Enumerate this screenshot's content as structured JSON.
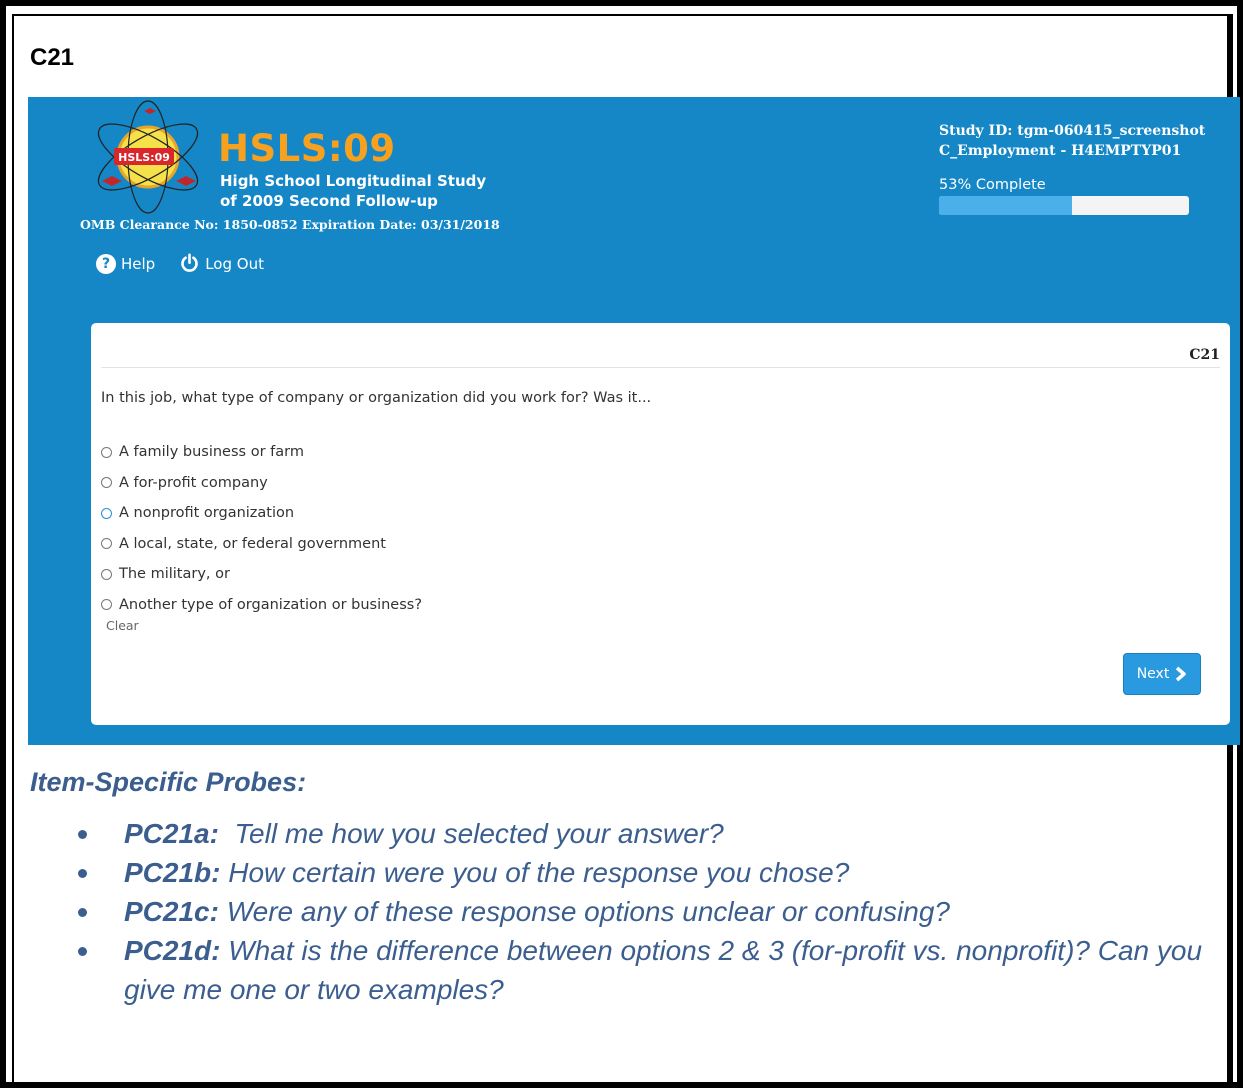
{
  "item_code": "C21",
  "app": {
    "brand_title": "HSLS:09",
    "brand_subtitle_line1": "High School Longitudinal Study",
    "brand_subtitle_line2": "of 2009 Second Follow-up",
    "logo_badge": "HSLS:09",
    "omb_notice": "OMB Clearance No: 1850-0852 Expiration Date: 03/31/2018",
    "help_label": "Help",
    "logout_label": "Log Out",
    "study_id": "Study ID: tgm-060415_screenshot",
    "section": "C_Employment - H4EMPTYP01",
    "progress_label": "53% Complete",
    "progress_percent": 53
  },
  "question": {
    "code": "C21",
    "text": "In this job, what type of company or organization did you work for? Was it...",
    "options": [
      "A family business or farm",
      "A for-profit company",
      "A nonprofit organization",
      "A local, state, or federal government",
      "The military, or",
      "Another type of organization or business?"
    ],
    "clear_label": "Clear",
    "next_label": "Next"
  },
  "probes": {
    "heading": "Item-Specific Probes:",
    "items": [
      {
        "code": "PC21a:",
        "text": "  Tell me how you selected your answer?"
      },
      {
        "code": "PC21b:",
        "text": " How certain were you of the response you chose?"
      },
      {
        "code": "PC21c:",
        "text": " Were any of these response options unclear or confusing?"
      },
      {
        "code": "PC21d:",
        "text": " What is the difference between options 2 & 3 (for-profit vs. nonprofit)? Can you give me one or two examples?"
      }
    ]
  },
  "colors": {
    "header_blue": "#1587c7",
    "brand_orange": "#f8a11e",
    "button_blue": "#2a9ae0",
    "probe_text": "#3b5e8f"
  }
}
